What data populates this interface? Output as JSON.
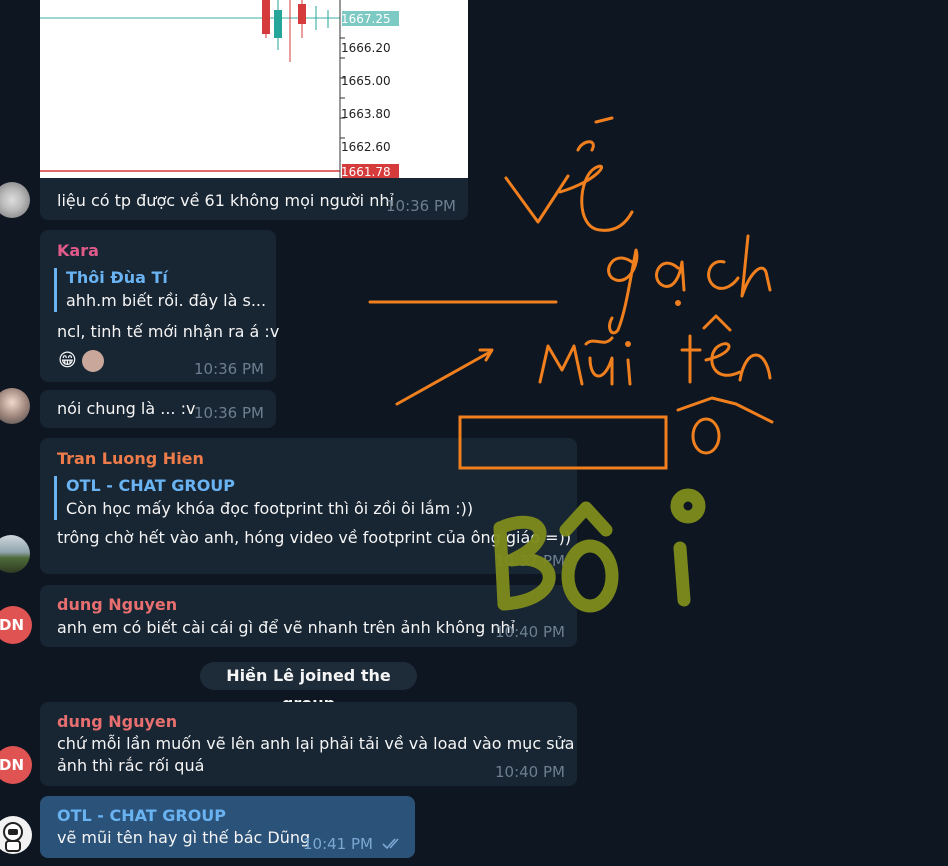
{
  "chart_image": {
    "price_labels": [
      "1666.20",
      "1665.00",
      "1663.80",
      "1662.60"
    ],
    "current_price": "1667.25",
    "low_price": "1661.78"
  },
  "messages": [
    {
      "text": "liệu có tp được về 61 không mọi người nhỉ",
      "time": "10:36 PM"
    },
    {
      "sender": "Kara",
      "sender_color": "#e05a8a",
      "quote_name": "Thôi Đùa Tí",
      "quote_text": "ahh.m biết rồi. đây là s...",
      "text": "ncl, tinh tế mới nhận ra á :v",
      "time": "10:36 PM",
      "reaction": "😁"
    },
    {
      "text": "nói chung là ... :v",
      "time": "10:36 PM"
    },
    {
      "sender": "Tran Luong Hien",
      "sender_color": "#ee7c4a",
      "quote_name": "OTL - CHAT GROUP",
      "quote_text": "Còn học mấy khóa đọc footprint thì ôi zồi ôi lắm :))",
      "text": "trông chờ hết vào anh, hóng video về footprint của ông giáo =))",
      "time": "10:37 PM"
    },
    {
      "sender": "dung Nguyen",
      "sender_color": "#e86f6f",
      "text": "anh em có biết cài cái gì để vẽ nhanh trên ảnh không nhỉ",
      "time": "10:40 PM",
      "avatar_initials": "DN"
    },
    {
      "sender": "dung Nguyen",
      "sender_color": "#e86f6f",
      "text_line1": "chứ mỗi lần muốn vẽ lên anh lại phải tải về và load vào mục sửa",
      "text_line2": "ảnh thì rắc rối quá",
      "time": "10:40 PM",
      "avatar_initials": "DN"
    },
    {
      "sender": "OTL - CHAT GROUP",
      "sender_color": "#6ab3f3",
      "text": "vẽ mũi tên hay gì thế bác Dũng",
      "time": "10:41 PM"
    }
  ],
  "service": {
    "text": "Hiền Lê joined the group"
  },
  "colors": {
    "background": "#0e1621",
    "bubble_in": "#182533",
    "bubble_out": "#2b5278",
    "annotation_orange": "#f07f1e",
    "annotation_olive": "#7f8c1c"
  }
}
